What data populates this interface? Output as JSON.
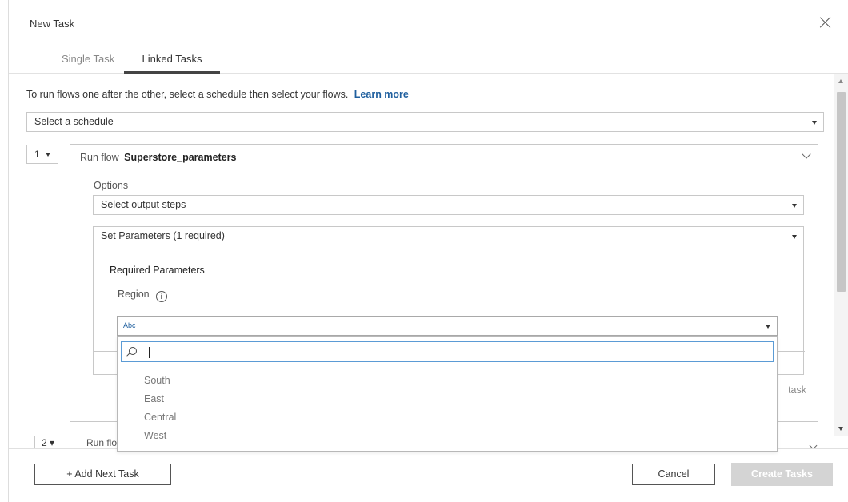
{
  "dialog": {
    "title": "New Task",
    "tabs": [
      {
        "label": "Single Task",
        "active": false
      },
      {
        "label": "Linked Tasks",
        "active": true
      }
    ]
  },
  "intro": {
    "text": "To run flows one after the other, select a schedule then select your flows.",
    "learn_more": "Learn more"
  },
  "schedule": {
    "placeholder": "Select a schedule"
  },
  "task1": {
    "step_number": "1",
    "run_flow_label": "Run flow",
    "flow_name": "Superstore_parameters",
    "options_label": "Options",
    "output_steps": "Select output steps",
    "set_parameters": "Set Parameters (1 required)",
    "required_parameters_heading": "Required Parameters",
    "parameter_name": "Region",
    "parameter_type": "Abc",
    "add_task_hint": "task"
  },
  "region_dropdown": {
    "search_value": "",
    "options": [
      "South",
      "East",
      "Central",
      "West"
    ]
  },
  "task2": {
    "step_number": "2",
    "run_flow_label": "Run flow"
  },
  "footer": {
    "add_next": "+ Add Next Task",
    "cancel": "Cancel",
    "create": "Create Tasks"
  },
  "colors": {
    "link": "#1f5f9e",
    "focus_border": "#5b9bd5",
    "disabled_button": "#d4d4d4"
  },
  "icons": [
    "close-icon",
    "caret-down-icon",
    "chevron-down-icon",
    "info-icon",
    "search-icon"
  ]
}
